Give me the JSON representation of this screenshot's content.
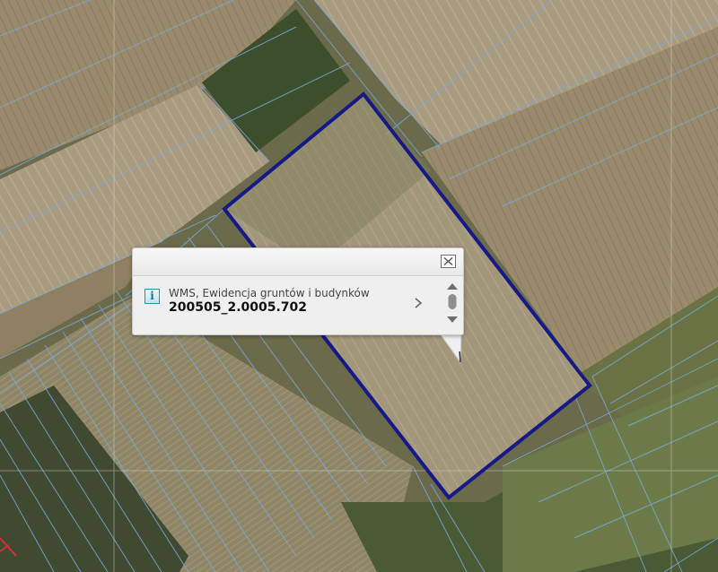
{
  "map": {
    "parcel_outline_color": "#151a86",
    "parcel_line_color": "#7aa8d8"
  },
  "popup": {
    "info_icon_glyph": "i",
    "layer_name": "WMS, Ewidencja gruntów i budynków",
    "feature_id": "200505_2.0005.702",
    "icons": [
      "close-icon",
      "info-icon",
      "chevron-right-icon",
      "scroll-up-icon",
      "scroll-down-icon"
    ]
  }
}
